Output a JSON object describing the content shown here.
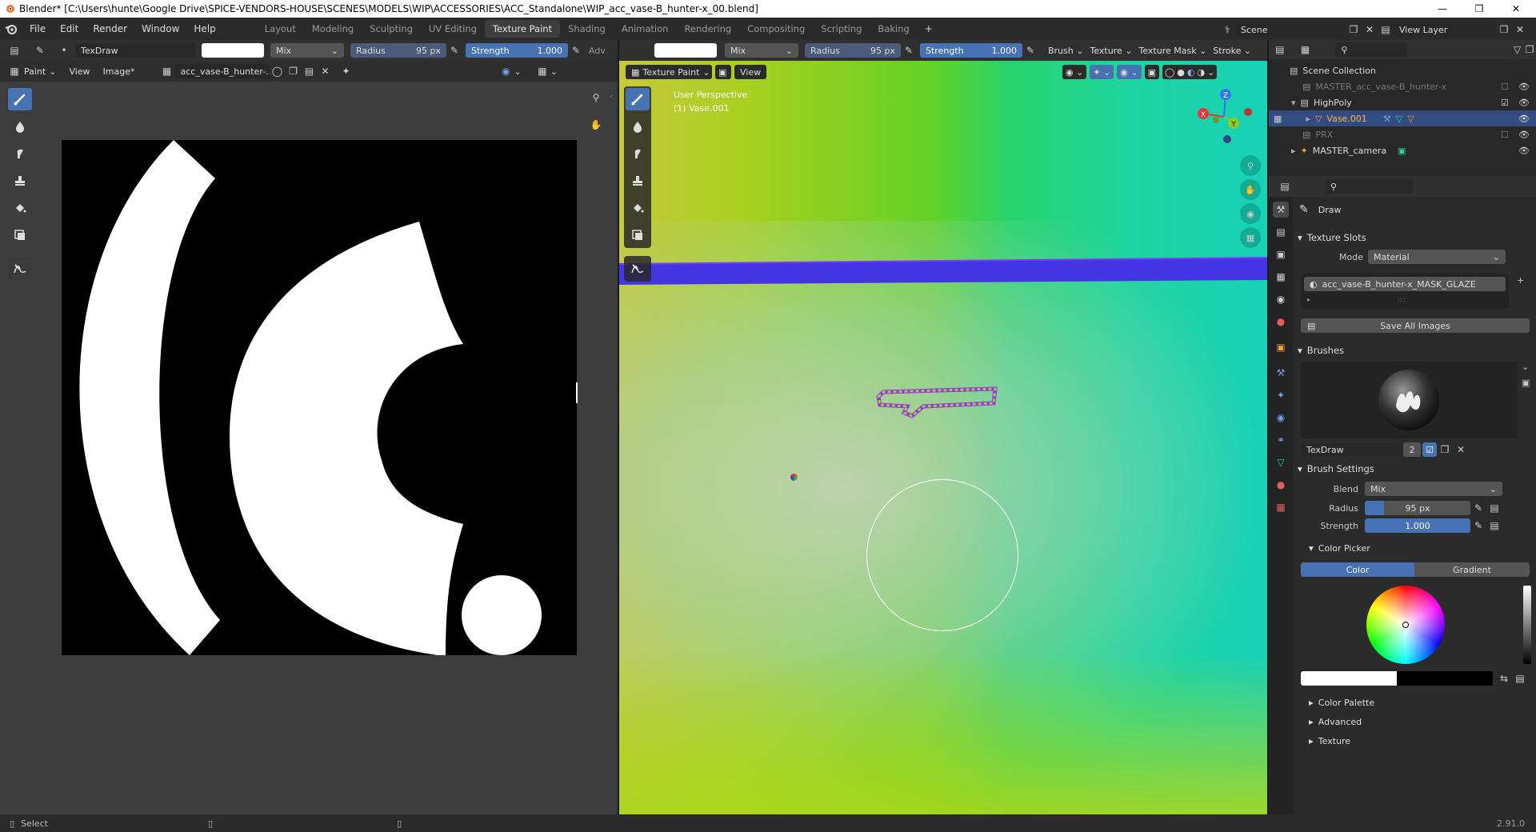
{
  "window": {
    "title": "Blender* [C:\\Users\\hunte\\Google Drive\\SPICE-VENDORS-HOUSE\\SCENES\\MODELS\\WIP\\ACCESSORIES\\ACC_Standalone\\WIP_acc_vase-B_hunter-x_00.blend]"
  },
  "menu": [
    "File",
    "Edit",
    "Render",
    "Window",
    "Help"
  ],
  "workspaces": [
    "Layout",
    "Modeling",
    "Sculpting",
    "UV Editing",
    "Texture Paint",
    "Shading",
    "Animation",
    "Rendering",
    "Compositing",
    "Scripting",
    "Baking"
  ],
  "active_workspace": "Texture Paint",
  "scene": {
    "name": "Scene",
    "view_layer": "View Layer"
  },
  "image_editor": {
    "brush_name": "TexDraw",
    "blend": "Mix",
    "radius_label": "Radius",
    "radius_value": "95 px",
    "strength_label": "Strength",
    "strength_value": "1.000",
    "adv_label": "Adv",
    "mode": "Paint",
    "view_menu": "View",
    "image_menu": "Image*",
    "image_name": "acc_vase-B_hunter-..."
  },
  "viewport": {
    "blend": "Mix",
    "radius_label": "Radius",
    "radius_value": "95 px",
    "strength_label": "Strength",
    "strength_value": "1.000",
    "menus": [
      "Brush",
      "Texture",
      "Texture Mask",
      "Stroke"
    ],
    "mode": "Texture Paint",
    "view_menu": "View",
    "overlay_line1": "User Perspective",
    "overlay_line2": "(1) Vase.001",
    "axes": {
      "x": "X",
      "y": "Y",
      "z": "Z"
    }
  },
  "outliner": {
    "items": [
      {
        "label": "Scene Collection"
      },
      {
        "label": "MASTER_acc_vase-B_hunter-x"
      },
      {
        "label": "HighPoly"
      },
      {
        "label": "Vase.001"
      },
      {
        "label": "PRX"
      },
      {
        "label": "MASTER_camera"
      }
    ]
  },
  "properties": {
    "tool_name": "Draw",
    "texture_slots": "Texture Slots",
    "mode_label": "Mode",
    "mode_value": "Material",
    "slot_name": "acc_vase-B_hunter-x_MASK_GLAZE",
    "save_all": "Save All Images",
    "brushes": "Brushes",
    "brush_name": "TexDraw",
    "brush_users": "2",
    "brush_settings": "Brush Settings",
    "blend_label": "Blend",
    "blend_value": "Mix",
    "radius_label": "Radius",
    "radius_value": "95 px",
    "strength_label": "Strength",
    "strength_value": "1.000",
    "color_picker": "Color Picker",
    "color_tab": "Color",
    "gradient_tab": "Gradient",
    "color_palette": "Color Palette",
    "advanced": "Advanced",
    "texture": "Texture"
  },
  "status": {
    "select": "Select",
    "version": "2.91.0"
  },
  "colors": {
    "accent": "#4772b3",
    "selected_row": "#334d80",
    "panel": "#2b2b2b",
    "header": "#303030"
  }
}
